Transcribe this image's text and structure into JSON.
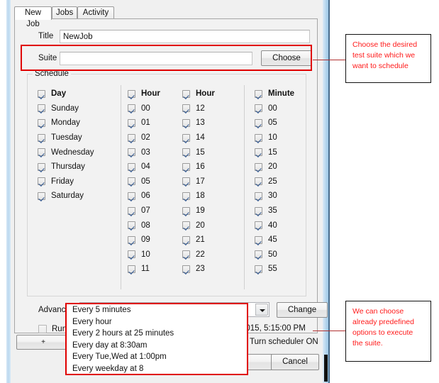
{
  "tabs": [
    {
      "label": "New Job",
      "active": true
    },
    {
      "label": "Jobs",
      "active": false
    },
    {
      "label": "Activity",
      "active": false
    }
  ],
  "form": {
    "title_label": "Title",
    "title_value": "NewJob",
    "title_placeholder": "",
    "suite_label": "Suite",
    "suite_value": "",
    "suite_placeholder": "",
    "choose_button": "Choose"
  },
  "schedule": {
    "legend": "Schedule",
    "columns": [
      {
        "header": "Day",
        "items": [
          "Sunday",
          "Monday",
          "Tuesday",
          "Wednesday",
          "Thursday",
          "Friday",
          "Saturday"
        ]
      },
      {
        "header": "Hour",
        "items": [
          "00",
          "01",
          "02",
          "03",
          "04",
          "05",
          "06",
          "07",
          "08",
          "09",
          "10",
          "11"
        ]
      },
      {
        "header": "Hour",
        "items": [
          "12",
          "13",
          "14",
          "15",
          "16",
          "17",
          "18",
          "19",
          "20",
          "21",
          "22",
          "23"
        ]
      },
      {
        "header": "Minute",
        "items": [
          "00",
          "05",
          "10",
          "15",
          "20",
          "25",
          "30",
          "35",
          "40",
          "45",
          "50",
          "55"
        ]
      }
    ]
  },
  "advanced": {
    "label": "Advanced",
    "combo_value": "",
    "combo_placeholder": "",
    "change_button": "Change",
    "options": [
      "Every 5 minutes",
      "Every hour",
      "Every 2 hours at 25 minutes",
      "Every day at 8:30am",
      "Every Tue,Wed at 1:00pm",
      "Every weekday at 8"
    ]
  },
  "run_now": {
    "label": "Run No",
    "date_text": "2015, 5:15:00 PM"
  },
  "footer": {
    "plus_button": "+",
    "scheduler_text": "Turn scheduler ON",
    "ok_button": "",
    "cancel_button": "Cancel"
  },
  "annotations": [
    {
      "text": "Choose the desired test suite which we want to schedule",
      "color": "#ff1a1a"
    },
    {
      "text": "We can choose already predefined options to execute the suite.",
      "color": "#ff1a1a"
    }
  ],
  "colors": {
    "highlight": "#e00000",
    "annotation_text": "#ff1a1a",
    "window_border": "#9ec8e6"
  }
}
